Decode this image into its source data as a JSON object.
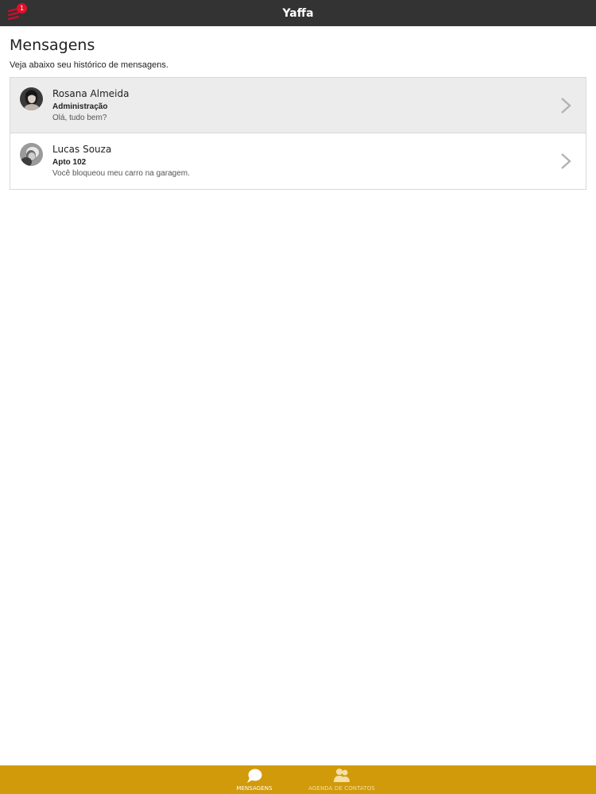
{
  "topbar": {
    "title": "Yaffa",
    "notification_count": "1"
  },
  "page": {
    "title": "Mensagens",
    "subtitle": "Veja abaixo seu histórico de mensagens."
  },
  "messages": [
    {
      "name": "Rosana Almeida",
      "group": "Administração",
      "preview": "Olá, tudo bem?",
      "selected": true
    },
    {
      "name": "Lucas Souza",
      "group": "Apto 102",
      "preview": "Você bloqueou meu carro na garagem.",
      "selected": false
    }
  ],
  "tabbar": {
    "tabs": [
      {
        "label": "MENSAGENS",
        "icon": "chat-bubble-icon",
        "active": true
      },
      {
        "label": "AGENDA DE CONTATOS",
        "icon": "contacts-icon",
        "active": false
      }
    ]
  },
  "colors": {
    "topbar": "#333333",
    "accent": "#d19a0a",
    "badge": "#e3102a",
    "selected_row": "#ececed"
  }
}
